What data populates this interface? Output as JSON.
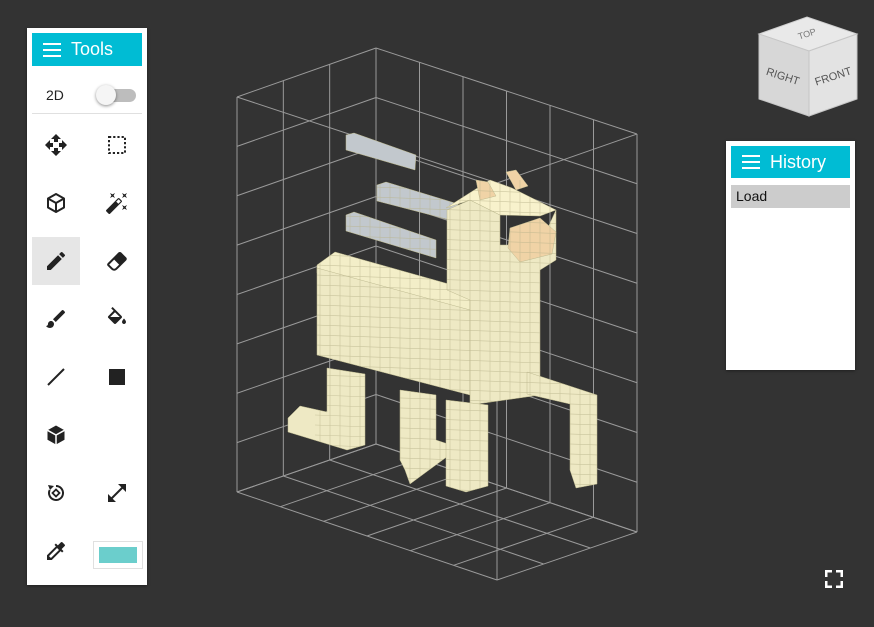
{
  "tools_panel": {
    "title": "Tools",
    "mode_label": "2D",
    "mode_2d_on": false,
    "tools": [
      {
        "name": "move-tool",
        "icon": "move-icon",
        "active": false
      },
      {
        "name": "select-tool",
        "icon": "select-rect-icon",
        "active": false
      },
      {
        "name": "voxel-tool",
        "icon": "cube-outline-icon",
        "active": false
      },
      {
        "name": "magic-wand-tool",
        "icon": "magic-wand-icon",
        "active": false
      },
      {
        "name": "pencil-tool",
        "icon": "pencil-icon",
        "active": true
      },
      {
        "name": "eraser-tool",
        "icon": "eraser-icon",
        "active": false
      },
      {
        "name": "brush-tool",
        "icon": "brush-icon",
        "active": false
      },
      {
        "name": "fill-tool",
        "icon": "paint-bucket-icon",
        "active": false
      },
      {
        "name": "line-tool",
        "icon": "line-icon",
        "active": false
      },
      {
        "name": "rectangle-tool",
        "icon": "square-icon",
        "active": false
      },
      {
        "name": "box-tool",
        "icon": "cube-solid-icon",
        "active": false
      },
      {
        "name": "rotate-tool",
        "icon": "rotate-icon",
        "active": false
      },
      {
        "name": "resize-tool",
        "icon": "expand-arrows-icon",
        "active": false
      },
      {
        "name": "eyedropper-tool",
        "icon": "eyedropper-icon",
        "active": false
      }
    ],
    "current_color": "#6bcecc"
  },
  "history_panel": {
    "title": "History",
    "items": [
      "Load"
    ]
  },
  "view_cube": {
    "top": "TOP",
    "right": "RIGHT",
    "front": "FRONT"
  },
  "colors": {
    "accent": "#00bcd4",
    "background": "#333333",
    "voxel_body": "#eee9c4",
    "voxel_accent": "#f0d3a6",
    "voxel_grey": "#c2c8cd"
  }
}
